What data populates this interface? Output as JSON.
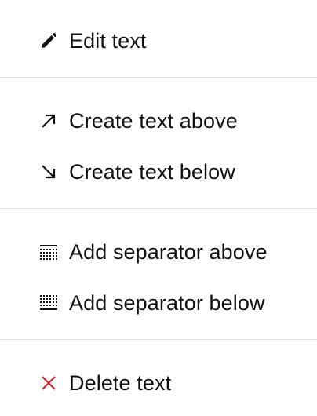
{
  "menu": {
    "items": [
      {
        "label": "Edit text",
        "icon": "pencil-icon"
      },
      {
        "label": "Create text above",
        "icon": "arrow-up-right-icon"
      },
      {
        "label": "Create text below",
        "icon": "arrow-down-right-icon"
      },
      {
        "label": "Add separator above",
        "icon": "separator-above-icon"
      },
      {
        "label": "Add separator below",
        "icon": "separator-below-icon"
      },
      {
        "label": "Delete text",
        "icon": "close-icon"
      }
    ]
  },
  "colors": {
    "text": "#111111",
    "divider": "#dedede",
    "delete_icon": "#d7262b"
  }
}
